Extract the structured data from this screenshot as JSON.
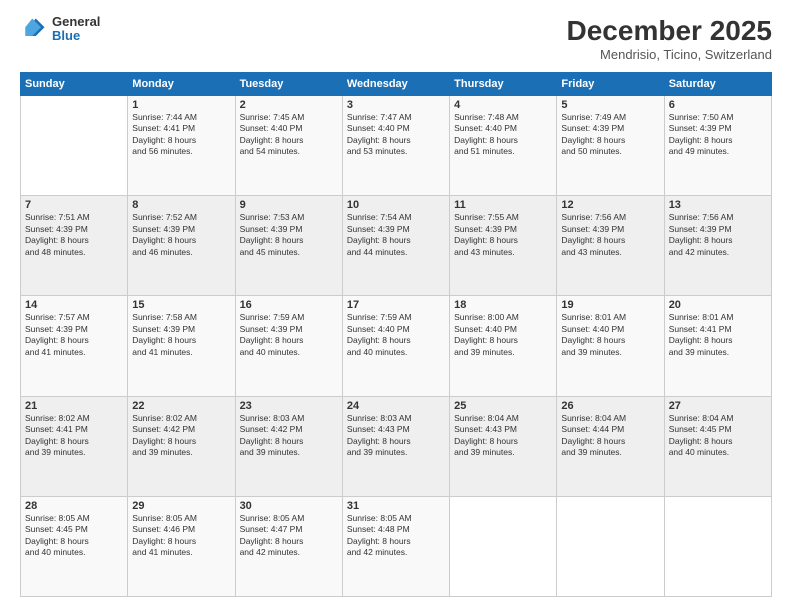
{
  "header": {
    "logo_general": "General",
    "logo_blue": "Blue",
    "month_year": "December 2025",
    "location": "Mendrisio, Ticino, Switzerland"
  },
  "calendar": {
    "days_of_week": [
      "Sunday",
      "Monday",
      "Tuesday",
      "Wednesday",
      "Thursday",
      "Friday",
      "Saturday"
    ],
    "weeks": [
      [
        {
          "day": "",
          "detail": ""
        },
        {
          "day": "1",
          "detail": "Sunrise: 7:44 AM\nSunset: 4:41 PM\nDaylight: 8 hours\nand 56 minutes."
        },
        {
          "day": "2",
          "detail": "Sunrise: 7:45 AM\nSunset: 4:40 PM\nDaylight: 8 hours\nand 54 minutes."
        },
        {
          "day": "3",
          "detail": "Sunrise: 7:47 AM\nSunset: 4:40 PM\nDaylight: 8 hours\nand 53 minutes."
        },
        {
          "day": "4",
          "detail": "Sunrise: 7:48 AM\nSunset: 4:40 PM\nDaylight: 8 hours\nand 51 minutes."
        },
        {
          "day": "5",
          "detail": "Sunrise: 7:49 AM\nSunset: 4:39 PM\nDaylight: 8 hours\nand 50 minutes."
        },
        {
          "day": "6",
          "detail": "Sunrise: 7:50 AM\nSunset: 4:39 PM\nDaylight: 8 hours\nand 49 minutes."
        }
      ],
      [
        {
          "day": "7",
          "detail": "Sunrise: 7:51 AM\nSunset: 4:39 PM\nDaylight: 8 hours\nand 48 minutes."
        },
        {
          "day": "8",
          "detail": "Sunrise: 7:52 AM\nSunset: 4:39 PM\nDaylight: 8 hours\nand 46 minutes."
        },
        {
          "day": "9",
          "detail": "Sunrise: 7:53 AM\nSunset: 4:39 PM\nDaylight: 8 hours\nand 45 minutes."
        },
        {
          "day": "10",
          "detail": "Sunrise: 7:54 AM\nSunset: 4:39 PM\nDaylight: 8 hours\nand 44 minutes."
        },
        {
          "day": "11",
          "detail": "Sunrise: 7:55 AM\nSunset: 4:39 PM\nDaylight: 8 hours\nand 43 minutes."
        },
        {
          "day": "12",
          "detail": "Sunrise: 7:56 AM\nSunset: 4:39 PM\nDaylight: 8 hours\nand 43 minutes."
        },
        {
          "day": "13",
          "detail": "Sunrise: 7:56 AM\nSunset: 4:39 PM\nDaylight: 8 hours\nand 42 minutes."
        }
      ],
      [
        {
          "day": "14",
          "detail": "Sunrise: 7:57 AM\nSunset: 4:39 PM\nDaylight: 8 hours\nand 41 minutes."
        },
        {
          "day": "15",
          "detail": "Sunrise: 7:58 AM\nSunset: 4:39 PM\nDaylight: 8 hours\nand 41 minutes."
        },
        {
          "day": "16",
          "detail": "Sunrise: 7:59 AM\nSunset: 4:39 PM\nDaylight: 8 hours\nand 40 minutes."
        },
        {
          "day": "17",
          "detail": "Sunrise: 7:59 AM\nSunset: 4:40 PM\nDaylight: 8 hours\nand 40 minutes."
        },
        {
          "day": "18",
          "detail": "Sunrise: 8:00 AM\nSunset: 4:40 PM\nDaylight: 8 hours\nand 39 minutes."
        },
        {
          "day": "19",
          "detail": "Sunrise: 8:01 AM\nSunset: 4:40 PM\nDaylight: 8 hours\nand 39 minutes."
        },
        {
          "day": "20",
          "detail": "Sunrise: 8:01 AM\nSunset: 4:41 PM\nDaylight: 8 hours\nand 39 minutes."
        }
      ],
      [
        {
          "day": "21",
          "detail": "Sunrise: 8:02 AM\nSunset: 4:41 PM\nDaylight: 8 hours\nand 39 minutes."
        },
        {
          "day": "22",
          "detail": "Sunrise: 8:02 AM\nSunset: 4:42 PM\nDaylight: 8 hours\nand 39 minutes."
        },
        {
          "day": "23",
          "detail": "Sunrise: 8:03 AM\nSunset: 4:42 PM\nDaylight: 8 hours\nand 39 minutes."
        },
        {
          "day": "24",
          "detail": "Sunrise: 8:03 AM\nSunset: 4:43 PM\nDaylight: 8 hours\nand 39 minutes."
        },
        {
          "day": "25",
          "detail": "Sunrise: 8:04 AM\nSunset: 4:43 PM\nDaylight: 8 hours\nand 39 minutes."
        },
        {
          "day": "26",
          "detail": "Sunrise: 8:04 AM\nSunset: 4:44 PM\nDaylight: 8 hours\nand 39 minutes."
        },
        {
          "day": "27",
          "detail": "Sunrise: 8:04 AM\nSunset: 4:45 PM\nDaylight: 8 hours\nand 40 minutes."
        }
      ],
      [
        {
          "day": "28",
          "detail": "Sunrise: 8:05 AM\nSunset: 4:45 PM\nDaylight: 8 hours\nand 40 minutes."
        },
        {
          "day": "29",
          "detail": "Sunrise: 8:05 AM\nSunset: 4:46 PM\nDaylight: 8 hours\nand 41 minutes."
        },
        {
          "day": "30",
          "detail": "Sunrise: 8:05 AM\nSunset: 4:47 PM\nDaylight: 8 hours\nand 42 minutes."
        },
        {
          "day": "31",
          "detail": "Sunrise: 8:05 AM\nSunset: 4:48 PM\nDaylight: 8 hours\nand 42 minutes."
        },
        {
          "day": "",
          "detail": ""
        },
        {
          "day": "",
          "detail": ""
        },
        {
          "day": "",
          "detail": ""
        }
      ]
    ]
  }
}
